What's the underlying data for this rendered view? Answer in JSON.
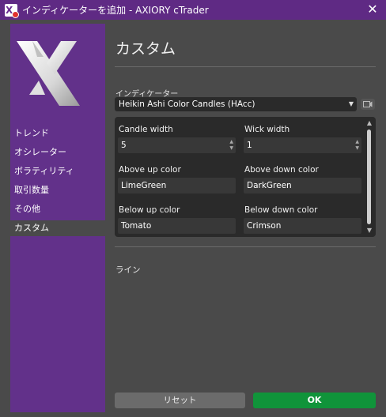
{
  "window": {
    "title": "インディケーターを追加 - AXIORY cTrader"
  },
  "sidebar": {
    "items": [
      {
        "label": "トレンド",
        "active": false
      },
      {
        "label": "オシレーター",
        "active": false
      },
      {
        "label": "ボラティリティ",
        "active": false
      },
      {
        "label": "取引数量",
        "active": false
      },
      {
        "label": "その他",
        "active": false
      },
      {
        "label": "カスタム",
        "active": true
      }
    ]
  },
  "main": {
    "title": "カスタム",
    "indicator_label": "インディケーター",
    "indicator_value": "Heikin Ashi Color Candles (HAcc)",
    "params": {
      "candle_width_label": "Candle width",
      "candle_width_value": "5",
      "wick_width_label": "Wick width",
      "wick_width_value": "1",
      "above_up_label": "Above up color",
      "above_up_value": "LimeGreen",
      "above_down_label": "Above down color",
      "above_down_value": "DarkGreen",
      "below_up_label": "Below up color",
      "below_up_value": "Tomato",
      "below_down_label": "Below down color",
      "below_down_value": "Crimson"
    },
    "line_label": "ライン"
  },
  "buttons": {
    "reset": "リセット",
    "ok": "OK"
  },
  "colors": {
    "accent": "#62318a",
    "ok": "#10943a",
    "background": "#4a4a4a"
  }
}
